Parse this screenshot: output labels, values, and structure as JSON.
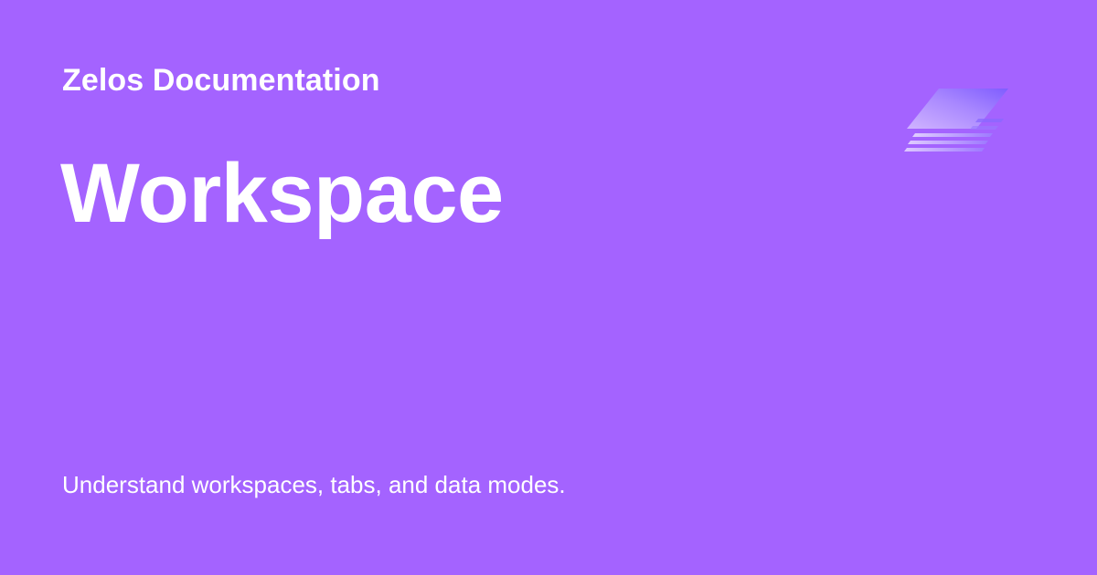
{
  "header": {
    "brand": "Zelos Documentation",
    "logo_icon": "layered-stack-icon"
  },
  "main": {
    "title": "Workspace",
    "description": "Understand workspaces, tabs, and data modes."
  },
  "colors": {
    "background": "#a463ff",
    "text": "#ffffff",
    "logo_light": "#cfb2ff",
    "logo_mid": "#9c7dff",
    "logo_dark": "#7b57ff"
  }
}
